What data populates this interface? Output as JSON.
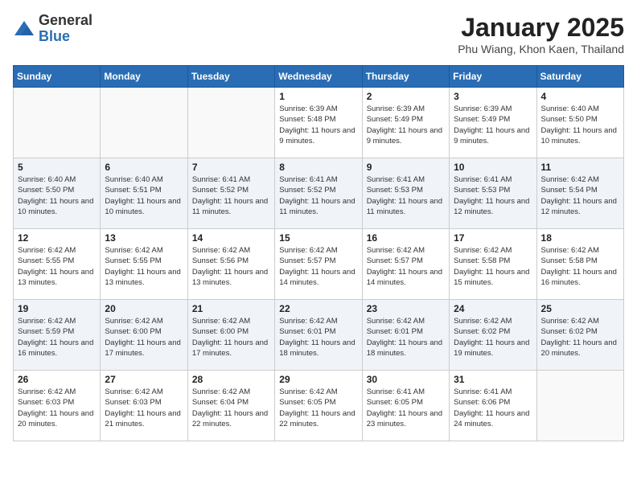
{
  "logo": {
    "general": "General",
    "blue": "Blue"
  },
  "title": "January 2025",
  "location": "Phu Wiang, Khon Kaen, Thailand",
  "weekdays": [
    "Sunday",
    "Monday",
    "Tuesday",
    "Wednesday",
    "Thursday",
    "Friday",
    "Saturday"
  ],
  "weeks": [
    [
      {
        "day": "",
        "sunrise": "",
        "sunset": "",
        "daylight": ""
      },
      {
        "day": "",
        "sunrise": "",
        "sunset": "",
        "daylight": ""
      },
      {
        "day": "",
        "sunrise": "",
        "sunset": "",
        "daylight": ""
      },
      {
        "day": "1",
        "sunrise": "Sunrise: 6:39 AM",
        "sunset": "Sunset: 5:48 PM",
        "daylight": "Daylight: 11 hours and 9 minutes."
      },
      {
        "day": "2",
        "sunrise": "Sunrise: 6:39 AM",
        "sunset": "Sunset: 5:49 PM",
        "daylight": "Daylight: 11 hours and 9 minutes."
      },
      {
        "day": "3",
        "sunrise": "Sunrise: 6:39 AM",
        "sunset": "Sunset: 5:49 PM",
        "daylight": "Daylight: 11 hours and 9 minutes."
      },
      {
        "day": "4",
        "sunrise": "Sunrise: 6:40 AM",
        "sunset": "Sunset: 5:50 PM",
        "daylight": "Daylight: 11 hours and 10 minutes."
      }
    ],
    [
      {
        "day": "5",
        "sunrise": "Sunrise: 6:40 AM",
        "sunset": "Sunset: 5:50 PM",
        "daylight": "Daylight: 11 hours and 10 minutes."
      },
      {
        "day": "6",
        "sunrise": "Sunrise: 6:40 AM",
        "sunset": "Sunset: 5:51 PM",
        "daylight": "Daylight: 11 hours and 10 minutes."
      },
      {
        "day": "7",
        "sunrise": "Sunrise: 6:41 AM",
        "sunset": "Sunset: 5:52 PM",
        "daylight": "Daylight: 11 hours and 11 minutes."
      },
      {
        "day": "8",
        "sunrise": "Sunrise: 6:41 AM",
        "sunset": "Sunset: 5:52 PM",
        "daylight": "Daylight: 11 hours and 11 minutes."
      },
      {
        "day": "9",
        "sunrise": "Sunrise: 6:41 AM",
        "sunset": "Sunset: 5:53 PM",
        "daylight": "Daylight: 11 hours and 11 minutes."
      },
      {
        "day": "10",
        "sunrise": "Sunrise: 6:41 AM",
        "sunset": "Sunset: 5:53 PM",
        "daylight": "Daylight: 11 hours and 12 minutes."
      },
      {
        "day": "11",
        "sunrise": "Sunrise: 6:42 AM",
        "sunset": "Sunset: 5:54 PM",
        "daylight": "Daylight: 11 hours and 12 minutes."
      }
    ],
    [
      {
        "day": "12",
        "sunrise": "Sunrise: 6:42 AM",
        "sunset": "Sunset: 5:55 PM",
        "daylight": "Daylight: 11 hours and 13 minutes."
      },
      {
        "day": "13",
        "sunrise": "Sunrise: 6:42 AM",
        "sunset": "Sunset: 5:55 PM",
        "daylight": "Daylight: 11 hours and 13 minutes."
      },
      {
        "day": "14",
        "sunrise": "Sunrise: 6:42 AM",
        "sunset": "Sunset: 5:56 PM",
        "daylight": "Daylight: 11 hours and 13 minutes."
      },
      {
        "day": "15",
        "sunrise": "Sunrise: 6:42 AM",
        "sunset": "Sunset: 5:57 PM",
        "daylight": "Daylight: 11 hours and 14 minutes."
      },
      {
        "day": "16",
        "sunrise": "Sunrise: 6:42 AM",
        "sunset": "Sunset: 5:57 PM",
        "daylight": "Daylight: 11 hours and 14 minutes."
      },
      {
        "day": "17",
        "sunrise": "Sunrise: 6:42 AM",
        "sunset": "Sunset: 5:58 PM",
        "daylight": "Daylight: 11 hours and 15 minutes."
      },
      {
        "day": "18",
        "sunrise": "Sunrise: 6:42 AM",
        "sunset": "Sunset: 5:58 PM",
        "daylight": "Daylight: 11 hours and 16 minutes."
      }
    ],
    [
      {
        "day": "19",
        "sunrise": "Sunrise: 6:42 AM",
        "sunset": "Sunset: 5:59 PM",
        "daylight": "Daylight: 11 hours and 16 minutes."
      },
      {
        "day": "20",
        "sunrise": "Sunrise: 6:42 AM",
        "sunset": "Sunset: 6:00 PM",
        "daylight": "Daylight: 11 hours and 17 minutes."
      },
      {
        "day": "21",
        "sunrise": "Sunrise: 6:42 AM",
        "sunset": "Sunset: 6:00 PM",
        "daylight": "Daylight: 11 hours and 17 minutes."
      },
      {
        "day": "22",
        "sunrise": "Sunrise: 6:42 AM",
        "sunset": "Sunset: 6:01 PM",
        "daylight": "Daylight: 11 hours and 18 minutes."
      },
      {
        "day": "23",
        "sunrise": "Sunrise: 6:42 AM",
        "sunset": "Sunset: 6:01 PM",
        "daylight": "Daylight: 11 hours and 18 minutes."
      },
      {
        "day": "24",
        "sunrise": "Sunrise: 6:42 AM",
        "sunset": "Sunset: 6:02 PM",
        "daylight": "Daylight: 11 hours and 19 minutes."
      },
      {
        "day": "25",
        "sunrise": "Sunrise: 6:42 AM",
        "sunset": "Sunset: 6:02 PM",
        "daylight": "Daylight: 11 hours and 20 minutes."
      }
    ],
    [
      {
        "day": "26",
        "sunrise": "Sunrise: 6:42 AM",
        "sunset": "Sunset: 6:03 PM",
        "daylight": "Daylight: 11 hours and 20 minutes."
      },
      {
        "day": "27",
        "sunrise": "Sunrise: 6:42 AM",
        "sunset": "Sunset: 6:03 PM",
        "daylight": "Daylight: 11 hours and 21 minutes."
      },
      {
        "day": "28",
        "sunrise": "Sunrise: 6:42 AM",
        "sunset": "Sunset: 6:04 PM",
        "daylight": "Daylight: 11 hours and 22 minutes."
      },
      {
        "day": "29",
        "sunrise": "Sunrise: 6:42 AM",
        "sunset": "Sunset: 6:05 PM",
        "daylight": "Daylight: 11 hours and 22 minutes."
      },
      {
        "day": "30",
        "sunrise": "Sunrise: 6:41 AM",
        "sunset": "Sunset: 6:05 PM",
        "daylight": "Daylight: 11 hours and 23 minutes."
      },
      {
        "day": "31",
        "sunrise": "Sunrise: 6:41 AM",
        "sunset": "Sunset: 6:06 PM",
        "daylight": "Daylight: 11 hours and 24 minutes."
      },
      {
        "day": "",
        "sunrise": "",
        "sunset": "",
        "daylight": ""
      }
    ]
  ],
  "colors": {
    "header_bg": "#2a6db5",
    "logo_blue": "#2a6db5"
  }
}
